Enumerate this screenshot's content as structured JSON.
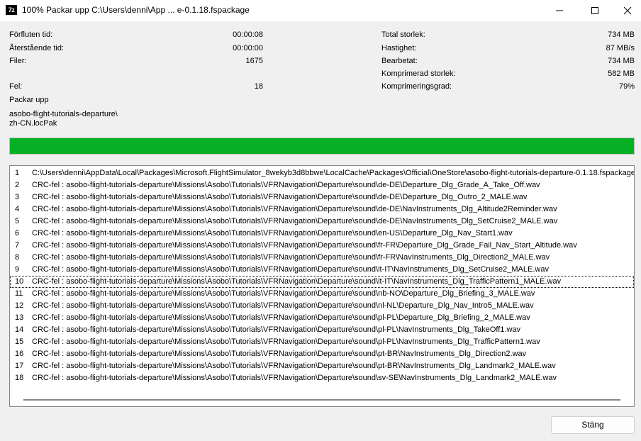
{
  "window": {
    "app_icon": "7z",
    "title": "100% Packar upp C:\\Users\\denni\\App ... e-0.1.18.fspackage",
    "icons": [
      "minimize-icon",
      "maximize-icon",
      "close-icon"
    ]
  },
  "stats_left": [
    {
      "label": "Förfluten tid:",
      "value": "00:00:08"
    },
    {
      "label": "Återstående tid:",
      "value": "00:00:00"
    },
    {
      "label": "Filer:",
      "value": "1675"
    },
    {
      "label": "Fel:",
      "value": "18"
    }
  ],
  "stats_right": [
    {
      "label": "Total storlek:",
      "value": "734 MB"
    },
    {
      "label": "Hastighet:",
      "value": "87 MB/s"
    },
    {
      "label": "Bearbetat:",
      "value": "734 MB"
    },
    {
      "label": "Komprimerad storlek:",
      "value": "582 MB"
    },
    {
      "label": "Komprimeringsgrad:",
      "value": "79%"
    }
  ],
  "operation": "Packar upp",
  "current_file_line1": "asobo-flight-tutorials-departure\\",
  "current_file_line2": "zh-CN.locPak",
  "progress_percent": 100,
  "progress_color": "#06b025",
  "log": [
    {
      "n": "1",
      "text": "C:\\Users\\denni\\AppData\\Local\\Packages\\Microsoft.FlightSimulator_8wekyb3d8bbwe\\LocalCache\\Packages\\Official\\OneStore\\asobo-flight-tutorials-departure-0.1.18.fspackage"
    },
    {
      "n": "2",
      "text": "CRC-fel : asobo-flight-tutorials-departure\\Missions\\Asobo\\Tutorials\\VFRNavigation\\Departure\\sound\\de-DE\\Departure_Dlg_Grade_A_Take_Off.wav"
    },
    {
      "n": "3",
      "text": "CRC-fel : asobo-flight-tutorials-departure\\Missions\\Asobo\\Tutorials\\VFRNavigation\\Departure\\sound\\de-DE\\Departure_Dlg_Outro_2_MALE.wav"
    },
    {
      "n": "4",
      "text": "CRC-fel : asobo-flight-tutorials-departure\\Missions\\Asobo\\Tutorials\\VFRNavigation\\Departure\\sound\\de-DE\\NavInstruments_Dlg_Altitude2Reminder.wav"
    },
    {
      "n": "5",
      "text": "CRC-fel : asobo-flight-tutorials-departure\\Missions\\Asobo\\Tutorials\\VFRNavigation\\Departure\\sound\\de-DE\\NavInstruments_Dlg_SetCruise2_MALE.wav"
    },
    {
      "n": "6",
      "text": "CRC-fel : asobo-flight-tutorials-departure\\Missions\\Asobo\\Tutorials\\VFRNavigation\\Departure\\sound\\en-US\\Departure_Dlg_Nav_Start1.wav"
    },
    {
      "n": "7",
      "text": "CRC-fel : asobo-flight-tutorials-departure\\Missions\\Asobo\\Tutorials\\VFRNavigation\\Departure\\sound\\fr-FR\\Departure_Dlg_Grade_Fail_Nav_Start_Altitude.wav"
    },
    {
      "n": "8",
      "text": "CRC-fel : asobo-flight-tutorials-departure\\Missions\\Asobo\\Tutorials\\VFRNavigation\\Departure\\sound\\fr-FR\\NavInstruments_Dlg_Direction2_MALE.wav"
    },
    {
      "n": "9",
      "text": "CRC-fel : asobo-flight-tutorials-departure\\Missions\\Asobo\\Tutorials\\VFRNavigation\\Departure\\sound\\it-IT\\NavInstruments_Dlg_SetCruise2_MALE.wav"
    },
    {
      "n": "10",
      "text": "CRC-fel : asobo-flight-tutorials-departure\\Missions\\Asobo\\Tutorials\\VFRNavigation\\Departure\\sound\\it-IT\\NavInstruments_Dlg_TrafficPattern1_MALE.wav"
    },
    {
      "n": "11",
      "text": "CRC-fel : asobo-flight-tutorials-departure\\Missions\\Asobo\\Tutorials\\VFRNavigation\\Departure\\sound\\nb-NO\\Departure_Dlg_Briefing_3_MALE.wav"
    },
    {
      "n": "12",
      "text": "CRC-fel : asobo-flight-tutorials-departure\\Missions\\Asobo\\Tutorials\\VFRNavigation\\Departure\\sound\\nl-NL\\Departure_Dlg_Nav_Intro5_MALE.wav"
    },
    {
      "n": "13",
      "text": "CRC-fel : asobo-flight-tutorials-departure\\Missions\\Asobo\\Tutorials\\VFRNavigation\\Departure\\sound\\pl-PL\\Departure_Dlg_Briefing_2_MALE.wav"
    },
    {
      "n": "14",
      "text": "CRC-fel : asobo-flight-tutorials-departure\\Missions\\Asobo\\Tutorials\\VFRNavigation\\Departure\\sound\\pl-PL\\NavInstruments_Dlg_TakeOff1.wav"
    },
    {
      "n": "15",
      "text": "CRC-fel : asobo-flight-tutorials-departure\\Missions\\Asobo\\Tutorials\\VFRNavigation\\Departure\\sound\\pl-PL\\NavInstruments_Dlg_TrafficPattern1.wav"
    },
    {
      "n": "16",
      "text": "CRC-fel : asobo-flight-tutorials-departure\\Missions\\Asobo\\Tutorials\\VFRNavigation\\Departure\\sound\\pt-BR\\NavInstruments_Dlg_Direction2.wav"
    },
    {
      "n": "17",
      "text": "CRC-fel : asobo-flight-tutorials-departure\\Missions\\Asobo\\Tutorials\\VFRNavigation\\Departure\\sound\\pt-BR\\NavInstruments_Dlg_Landmark2_MALE.wav"
    },
    {
      "n": "18",
      "text": "CRC-fel : asobo-flight-tutorials-departure\\Missions\\Asobo\\Tutorials\\VFRNavigation\\Departure\\sound\\sv-SE\\NavInstruments_Dlg_Landmark2_MALE.wav"
    }
  ],
  "focused_row": 10,
  "close_button": "Stäng"
}
